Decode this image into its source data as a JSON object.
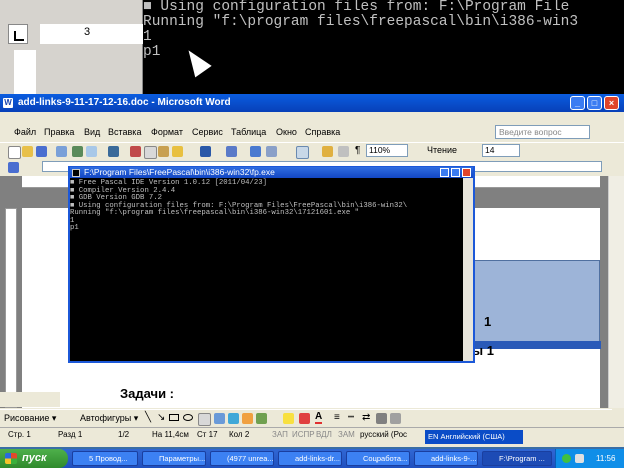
{
  "bg_console": {
    "lines": [
      "■ Using configuration files from: F:\\Program File",
      "Running \"f:\\program files\\freepascal\\bin\\i386-win3",
      "1",
      "p1"
    ],
    "ruler_number": "3"
  },
  "word": {
    "title": "add-links-9-11-17-12-16.doc - Microsoft Word",
    "menu": [
      "Файл",
      "Правка",
      "Вид",
      "Вставка",
      "Формат",
      "Сервис",
      "Таблица",
      "Окно",
      "Справка"
    ],
    "ask_placeholder": "Введите вопрос",
    "zoom": "110%",
    "reading_label": "Чтение",
    "font_size": "14",
    "doc_fragments": [
      "1",
      "ы 1"
    ],
    "doc_heading": "Задачи :",
    "draw_label": "Рисование",
    "autoshapes_label": "Автофигуры"
  },
  "fp_console": {
    "title": "F:\\Program Files\\FreePascal\\bin\\i386-win32\\fp.exe",
    "lines": [
      "■ Free Pascal IDE Version 1.0.12 [2011/04/23]",
      "■ Compiler Version 2.4.4",
      "■ GDB Version GDB 7.2",
      "■ Using configuration files from: F:\\Program Files\\FreePascal\\bin\\i386-win32\\",
      "Running \"f:\\program files\\freepascal\\bin\\i386-win32\\17121601.exe \"",
      "1",
      "p1"
    ]
  },
  "status": {
    "page": "Стр. 1",
    "section": "Разд 1",
    "pages": "1/2",
    "at": "На 11,4см",
    "line": "Ст 17",
    "col": "Кол 2",
    "zap": "ЗАП",
    "ispr": "ИСПР",
    "vdl": "ВДЛ",
    "zam": "ЗАМ",
    "lang": "русский (Рос",
    "lang_bar": "EN Английский (США)"
  },
  "taskbar": {
    "start": "пуск",
    "tasks": [
      "5 Провод...",
      "Параметры...",
      "(4977 unrea...",
      "add-links-dr...",
      "Соцработа...",
      "add-links-9-...",
      "F:\\Program ..."
    ],
    "clock": "11:56"
  }
}
